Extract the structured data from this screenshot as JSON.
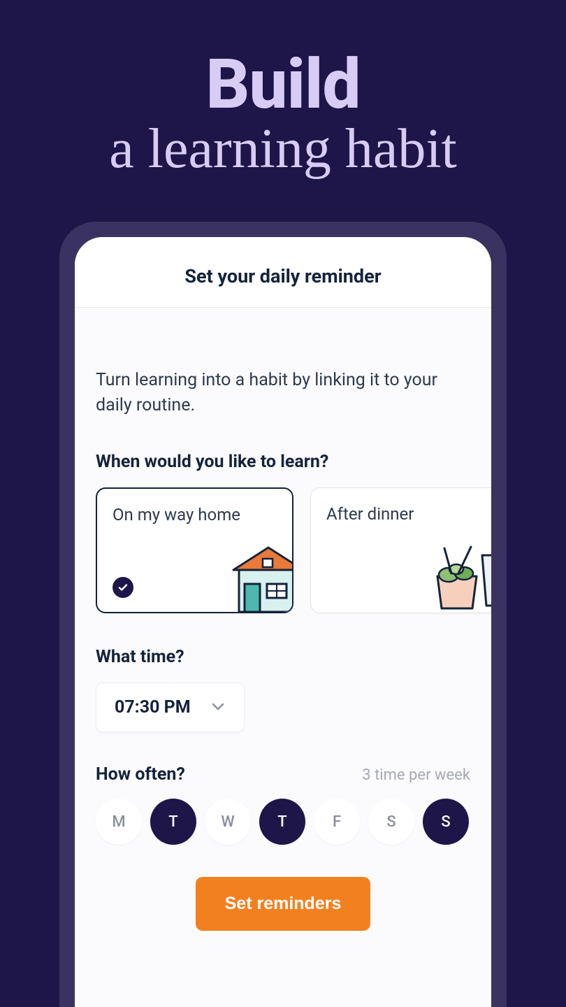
{
  "hero": {
    "line1": "Build",
    "line2": "a learning habit"
  },
  "header": {
    "title": "Set your daily reminder"
  },
  "intro": "Turn learning into a habit by linking it to your daily routine.",
  "when": {
    "question": "When would you like to learn?",
    "options": [
      {
        "label": "On my way home",
        "selected": true
      },
      {
        "label": "After dinner",
        "selected": false
      }
    ]
  },
  "time": {
    "question": "What time?",
    "value": "07:30 PM"
  },
  "often": {
    "question": "How often?",
    "summary": "3 time per week",
    "days": [
      {
        "label": "M",
        "on": false
      },
      {
        "label": "T",
        "on": true
      },
      {
        "label": "W",
        "on": false
      },
      {
        "label": "T",
        "on": true
      },
      {
        "label": "F",
        "on": false
      },
      {
        "label": "S",
        "on": false
      },
      {
        "label": "S",
        "on": true
      }
    ]
  },
  "cta": "Set reminders",
  "colors": {
    "bg": "#1e1548",
    "accent": "#f3801f",
    "lilac": "#d7cdf4"
  }
}
